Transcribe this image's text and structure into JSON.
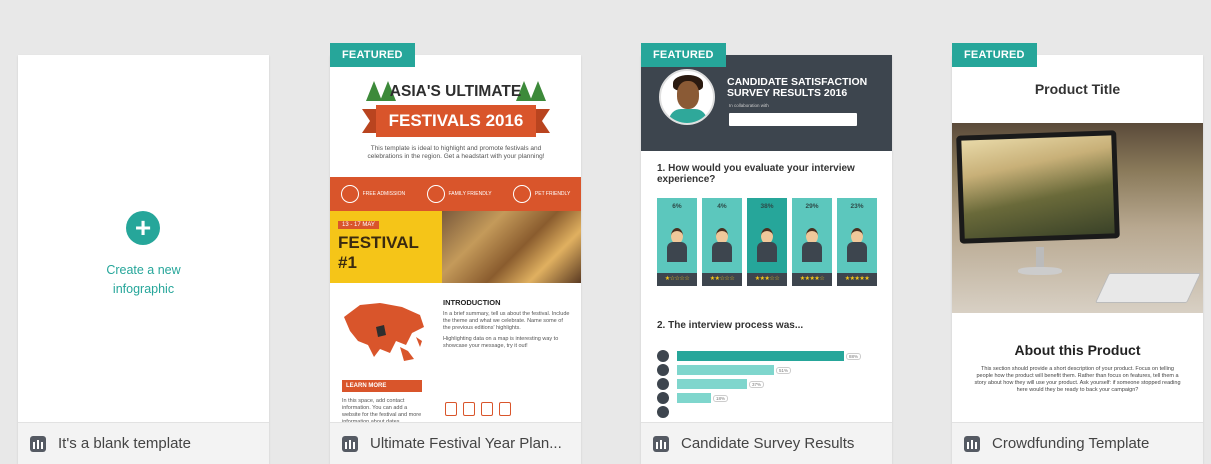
{
  "colors": {
    "accent": "#26a69a",
    "background": "#e8e8e8",
    "festival_orange": "#d9552b",
    "festival_yellow": "#f5c518",
    "survey_dark": "#3d454e"
  },
  "footer_icon": "infographic-bars-icon",
  "cards": {
    "blank": {
      "create_line1": "Create a new",
      "create_line2": "infographic",
      "title": "It's a blank template"
    },
    "festival": {
      "badge": "FEATURED",
      "title": "Ultimate Festival Year Plan...",
      "headline1": "ASIA'S ULTIMATE",
      "headline2": "FESTIVALS 2016",
      "intro_text": "This template is ideal to highlight and promote festivals and celebrations in the region. Get a headstart with your planning!",
      "features": [
        "FREE ADMISSION",
        "FAMILY FRIENDLY",
        "PET FRIENDLY"
      ],
      "date": "13 - 17 MAY",
      "festival_name": "FESTIVAL #1",
      "intro_heading": "INTRODUCTION",
      "intro_body": "In a brief summary, tell us about the festival. Include the theme and what we celebrate. Name some of the previous editions' highlights.",
      "intro_body2": "Highlighting data on a map is interesting way to showcase your message, try it out!",
      "learn_more": "LEARN MORE",
      "learn_text": "In this space, add contact information. You can add a website for the festival and more information about dates."
    },
    "candidate": {
      "badge": "FEATURED",
      "title": "Candidate Survey Results",
      "headline": "CANDIDATE SATISFACTION SURVEY RESULTS 2016",
      "collab": "In collaboration with",
      "question1": "1. How would you evaluate your interview experience?",
      "question2": "2. The interview process was...",
      "ratings": [
        {
          "pct": "6%",
          "stars": "★☆☆☆☆"
        },
        {
          "pct": "4%",
          "stars": "★★☆☆☆"
        },
        {
          "pct": "38%",
          "stars": "★★★☆☆"
        },
        {
          "pct": "29%",
          "stars": "★★★★☆"
        },
        {
          "pct": "23%",
          "stars": "★★★★★"
        }
      ],
      "process_bars": [
        {
          "label": "88%",
          "value": 0.88
        },
        {
          "label": "51%",
          "value": 0.51
        },
        {
          "label": "37%",
          "value": 0.37
        },
        {
          "label": "18%",
          "value": 0.18
        },
        {
          "label": "",
          "value": 0.0
        }
      ]
    },
    "crowdfunding": {
      "badge": "FEATURED",
      "title": "Crowdfunding Template",
      "product_title": "Product Title",
      "about_heading": "About this Product",
      "about_text": "This section should provide a short description of your product. Focus on telling people how the product will benefit them. Rather than focus on features, tell them a story about how they will use your product. Ask yourself: if someone stopped reading here would they be ready to back your campaign?"
    }
  }
}
